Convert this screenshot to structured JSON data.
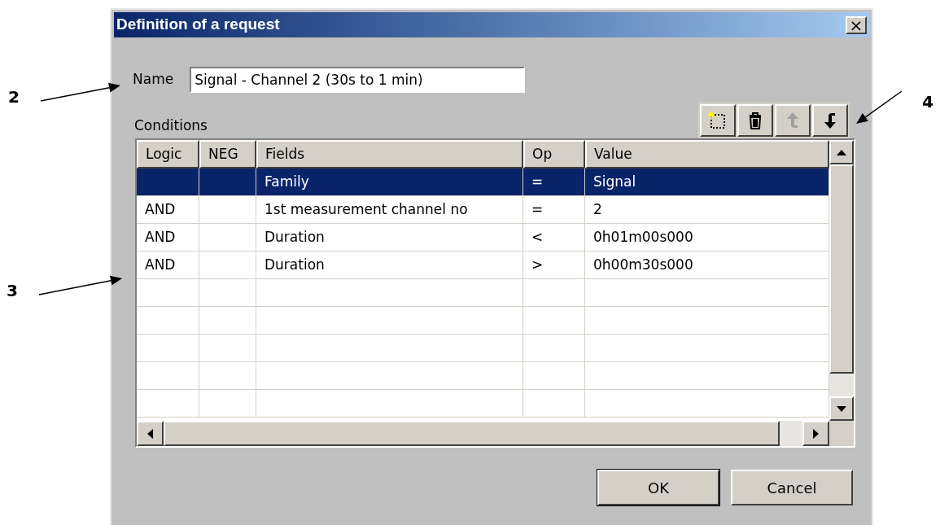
{
  "window": {
    "title": "Definition of a request",
    "close": "×"
  },
  "name_field": {
    "label": "Name",
    "value": "Signal - Channel 2 (30s to 1 min)"
  },
  "conditions": {
    "label": "Conditions",
    "toolbar": [
      {
        "kind": "new",
        "disabled": false
      },
      {
        "kind": "delete",
        "disabled": false
      },
      {
        "kind": "up",
        "disabled": true
      },
      {
        "kind": "down",
        "disabled": false
      }
    ],
    "columns": [
      "Logic",
      "NEG",
      "Fields",
      "Op",
      "Value"
    ],
    "rows": [
      {
        "selected": true,
        "cells": [
          "",
          "",
          "Family",
          "=",
          "Signal"
        ]
      },
      {
        "selected": false,
        "cells": [
          "AND",
          "",
          "1st measurement channel no",
          "=",
          "2"
        ]
      },
      {
        "selected": false,
        "cells": [
          "AND",
          "",
          "Duration",
          "<",
          "0h01m00s000"
        ]
      },
      {
        "selected": false,
        "cells": [
          "AND",
          "",
          "Duration",
          ">",
          "0h00m30s000"
        ]
      }
    ]
  },
  "buttons": [
    "OK",
    "Cancel"
  ],
  "callouts": [
    "2",
    "3",
    "4"
  ]
}
